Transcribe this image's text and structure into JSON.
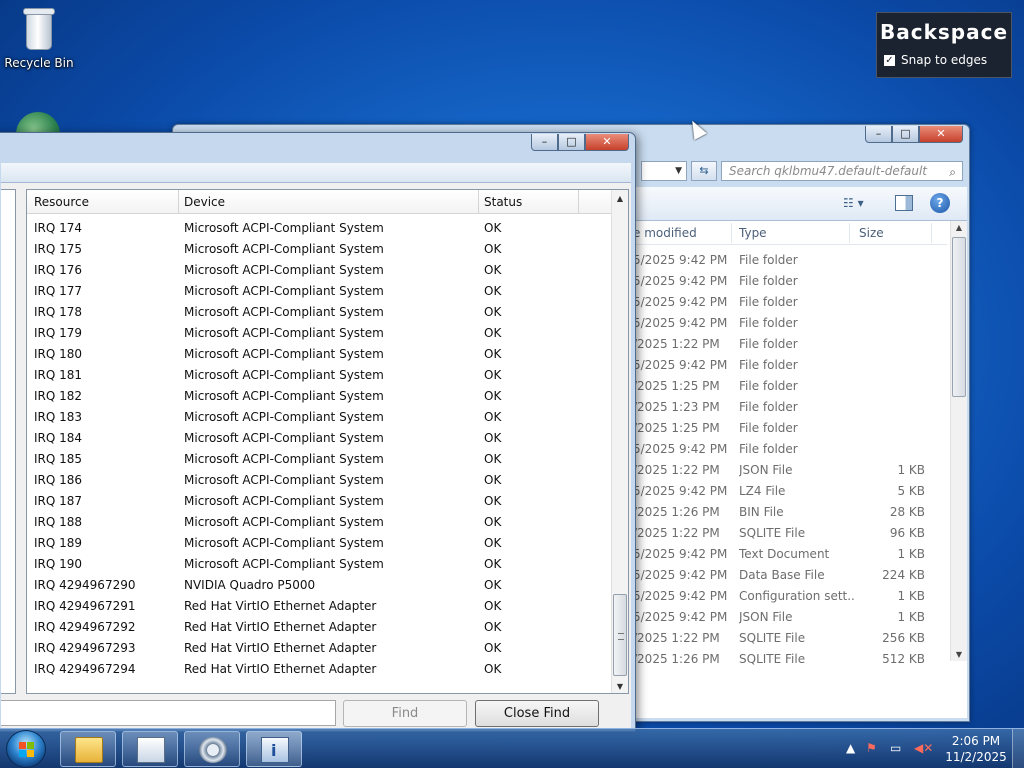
{
  "desktop": {
    "recycle_bin_label": "Recycle Bin"
  },
  "backspace_overlay": {
    "title": "Backspace",
    "snap_label": "Snap to edges",
    "snap_checked": true
  },
  "explorer": {
    "search_placeholder": "Search qklbmu47.default-default",
    "columns": [
      "e modified",
      "Type",
      "Size"
    ],
    "rows": [
      {
        "date": "5/2025 9:42 PM",
        "type": "File folder",
        "size": ""
      },
      {
        "date": "5/2025 9:42 PM",
        "type": "File folder",
        "size": ""
      },
      {
        "date": "5/2025 9:42 PM",
        "type": "File folder",
        "size": ""
      },
      {
        "date": "5/2025 9:42 PM",
        "type": "File folder",
        "size": ""
      },
      {
        "date": "/2025 1:22 PM",
        "type": "File folder",
        "size": ""
      },
      {
        "date": "5/2025 9:42 PM",
        "type": "File folder",
        "size": ""
      },
      {
        "date": "/2025 1:25 PM",
        "type": "File folder",
        "size": ""
      },
      {
        "date": "/2025 1:23 PM",
        "type": "File folder",
        "size": ""
      },
      {
        "date": "/2025 1:25 PM",
        "type": "File folder",
        "size": ""
      },
      {
        "date": "5/2025 9:42 PM",
        "type": "File folder",
        "size": ""
      },
      {
        "date": "/2025 1:22 PM",
        "type": "JSON File",
        "size": "1 KB"
      },
      {
        "date": "5/2025 9:42 PM",
        "type": "LZ4 File",
        "size": "5 KB"
      },
      {
        "date": "/2025 1:26 PM",
        "type": "BIN File",
        "size": "28 KB"
      },
      {
        "date": "/2025 1:22 PM",
        "type": "SQLITE File",
        "size": "96 KB"
      },
      {
        "date": "5/2025 9:42 PM",
        "type": "Text Document",
        "size": "1 KB"
      },
      {
        "date": "5/2025 9:42 PM",
        "type": "Data Base File",
        "size": "224 KB"
      },
      {
        "date": "5/2025 9:42 PM",
        "type": "Configuration sett...",
        "size": "1 KB"
      },
      {
        "date": "5/2025 9:42 PM",
        "type": "JSON File",
        "size": "1 KB"
      },
      {
        "date": "/2025 1:22 PM",
        "type": "SQLITE File",
        "size": "256 KB"
      },
      {
        "date": "/2025 1:26 PM",
        "type": "SQLITE File",
        "size": "512 KB"
      }
    ]
  },
  "sysinfo": {
    "columns": {
      "resource": "Resource",
      "device": "Device",
      "status": "Status"
    },
    "rows": [
      {
        "resource": "IRQ 174",
        "device": "Microsoft ACPI-Compliant System",
        "status": "OK"
      },
      {
        "resource": "IRQ 175",
        "device": "Microsoft ACPI-Compliant System",
        "status": "OK"
      },
      {
        "resource": "IRQ 176",
        "device": "Microsoft ACPI-Compliant System",
        "status": "OK"
      },
      {
        "resource": "IRQ 177",
        "device": "Microsoft ACPI-Compliant System",
        "status": "OK"
      },
      {
        "resource": "IRQ 178",
        "device": "Microsoft ACPI-Compliant System",
        "status": "OK"
      },
      {
        "resource": "IRQ 179",
        "device": "Microsoft ACPI-Compliant System",
        "status": "OK"
      },
      {
        "resource": "IRQ 180",
        "device": "Microsoft ACPI-Compliant System",
        "status": "OK"
      },
      {
        "resource": "IRQ 181",
        "device": "Microsoft ACPI-Compliant System",
        "status": "OK"
      },
      {
        "resource": "IRQ 182",
        "device": "Microsoft ACPI-Compliant System",
        "status": "OK"
      },
      {
        "resource": "IRQ 183",
        "device": "Microsoft ACPI-Compliant System",
        "status": "OK"
      },
      {
        "resource": "IRQ 184",
        "device": "Microsoft ACPI-Compliant System",
        "status": "OK"
      },
      {
        "resource": "IRQ 185",
        "device": "Microsoft ACPI-Compliant System",
        "status": "OK"
      },
      {
        "resource": "IRQ 186",
        "device": "Microsoft ACPI-Compliant System",
        "status": "OK"
      },
      {
        "resource": "IRQ 187",
        "device": "Microsoft ACPI-Compliant System",
        "status": "OK"
      },
      {
        "resource": "IRQ 188",
        "device": "Microsoft ACPI-Compliant System",
        "status": "OK"
      },
      {
        "resource": "IRQ 189",
        "device": "Microsoft ACPI-Compliant System",
        "status": "OK"
      },
      {
        "resource": "IRQ 190",
        "device": "Microsoft ACPI-Compliant System",
        "status": "OK"
      },
      {
        "resource": "IRQ 4294967290",
        "device": "NVIDIA Quadro P5000",
        "status": "OK"
      },
      {
        "resource": "IRQ 4294967291",
        "device": "Red Hat VirtIO Ethernet Adapter",
        "status": "OK"
      },
      {
        "resource": "IRQ 4294967292",
        "device": "Red Hat VirtIO Ethernet Adapter",
        "status": "OK"
      },
      {
        "resource": "IRQ 4294967293",
        "device": "Red Hat VirtIO Ethernet Adapter",
        "status": "OK"
      },
      {
        "resource": "IRQ 4294967294",
        "device": "Red Hat VirtIO Ethernet Adapter",
        "status": "OK"
      }
    ],
    "find_button": "Find",
    "close_find_button": "Close Find"
  },
  "taskbar": {
    "clock_time": "2:06 PM",
    "clock_date": "11/2/2025"
  },
  "colors": {
    "desktop_blue": "#1566c8",
    "window_frame": "#c5d8ee",
    "close_red": "#c7412b"
  }
}
